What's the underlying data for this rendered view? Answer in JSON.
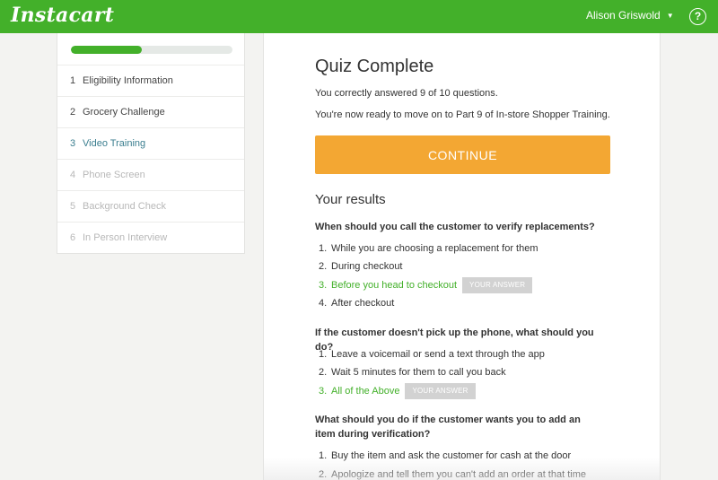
{
  "header": {
    "logo": "Instacart",
    "user_name": "Alison Griswold",
    "user_chevron": "⌄",
    "help_symbol": "?"
  },
  "sidebar": {
    "progress": 0.44,
    "steps": [
      {
        "num": "1",
        "label": "Eligibility Information",
        "state": "done"
      },
      {
        "num": "2",
        "label": "Grocery Challenge",
        "state": "done"
      },
      {
        "num": "3",
        "label": "Video Training",
        "state": "active"
      },
      {
        "num": "4",
        "label": "Phone Screen",
        "state": "locked"
      },
      {
        "num": "5",
        "label": "Background Check",
        "state": "locked"
      },
      {
        "num": "6",
        "label": "In Person Interview",
        "state": "locked"
      }
    ]
  },
  "main": {
    "title": "Quiz Complete",
    "score_text": "You correctly answered 9 of 10 questions.",
    "next_text": "You're now ready to move on to Part 9 of In-store Shopper Training.",
    "continue_label": "CONTINUE",
    "results_title": "Your results",
    "your_answer_badge": "YOUR ANSWER",
    "questions": [
      {
        "text": "When should you call the customer to verify replacements?",
        "answers": [
          {
            "num": "1.",
            "text": "While you are choosing a replacement for them"
          },
          {
            "num": "2.",
            "text": "During checkout"
          },
          {
            "num": "3.",
            "text": "Before you head to checkout"
          },
          {
            "num": "4.",
            "text": "After checkout"
          }
        ]
      },
      {
        "text": "If the customer doesn't pick up the phone, what should you do?",
        "answers": [
          {
            "num": "1.",
            "text": "Leave a voicemail or send a text through the app"
          },
          {
            "num": "2.",
            "text": "Wait 5 minutes for them to call you back"
          },
          {
            "num": "3.",
            "text": "All of the Above"
          }
        ]
      },
      {
        "text": "What should you do if the customer wants you to add an item during verification?",
        "answers": [
          {
            "num": "1.",
            "text": "Buy the item and ask the customer for cash at the door"
          },
          {
            "num": "2.",
            "text": "Apologize and tell them you can't add an order at that time"
          }
        ]
      }
    ]
  },
  "colors": {
    "brand_green": "#43b02a",
    "continue_orange": "#f3a733",
    "active_step": "#3b7e8f"
  }
}
